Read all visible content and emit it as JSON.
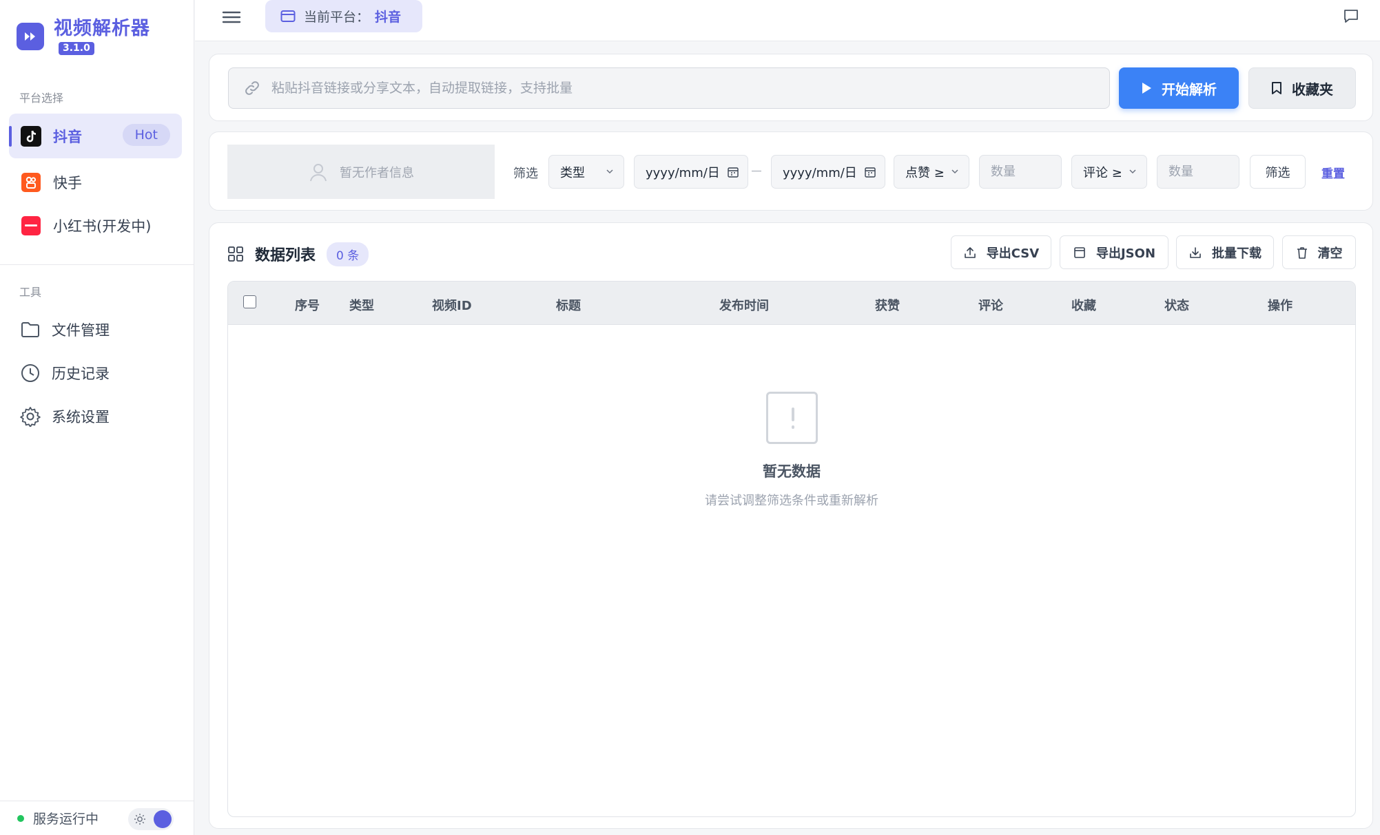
{
  "app": {
    "title": "视频解析器",
    "version": "3.1.0"
  },
  "sidebar": {
    "platform_section_label": "平台选择",
    "platforms": [
      {
        "label": "抖音",
        "badge": "Hot",
        "active": true
      },
      {
        "label": "快手"
      },
      {
        "label": "小红书(开发中)"
      }
    ],
    "tools_section_label": "工具",
    "tools": [
      {
        "label": "文件管理"
      },
      {
        "label": "历史记录"
      },
      {
        "label": "系统设置"
      }
    ],
    "status_text": "服务运行中"
  },
  "topbar": {
    "platform_label": "当前平台：",
    "platform_value": "抖音"
  },
  "url_input": {
    "placeholder": "粘贴抖音链接或分享文本，自动提取链接，支持批量",
    "value": ""
  },
  "buttons": {
    "parse": "开始解析",
    "favorites": "收藏夹"
  },
  "filter": {
    "author_placeholder": "暂无作者信息",
    "label": "筛选",
    "type_select": "类型",
    "date_from": "yyyy/mm/日",
    "date_to": "yyyy/mm/日",
    "likes_select": "点赞 ≥",
    "likes_placeholder": "数量",
    "comments_select": "评论 ≥",
    "comments_placeholder": "数量",
    "apply": "筛选",
    "reset": "重置"
  },
  "table": {
    "title": "数据列表",
    "count": "0 条",
    "actions": {
      "export_csv": "导出CSV",
      "export_json": "导出JSON",
      "batch_download": "批量下载",
      "clear": "清空"
    },
    "columns": [
      "序号",
      "类型",
      "视频ID",
      "标题",
      "发布时间",
      "获赞",
      "评论",
      "收藏",
      "状态",
      "操作"
    ],
    "rows": [],
    "empty_title": "暂无数据",
    "empty_subtitle": "请尝试调整筛选条件或重新解析"
  },
  "colors": {
    "accent": "#5b5fe0",
    "primary_button": "#3b82f6",
    "status_ok": "#22c55e"
  }
}
